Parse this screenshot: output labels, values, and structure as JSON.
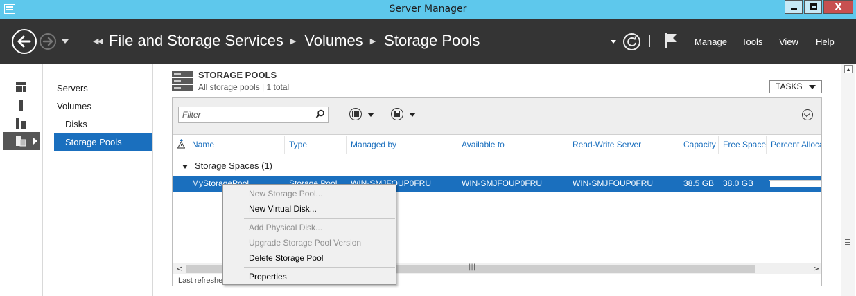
{
  "window": {
    "title": "Server Manager",
    "close_symbol": "X"
  },
  "header": {
    "breadcrumb": [
      "File and Storage Services",
      "Volumes",
      "Storage Pools"
    ],
    "menu": [
      "Manage",
      "Tools",
      "View",
      "Help"
    ]
  },
  "rail": {
    "icons": [
      "dashboard-icon",
      "local-server-icon",
      "all-servers-icon",
      "file-storage-icon"
    ]
  },
  "subnav": {
    "items": [
      {
        "label": "Servers"
      },
      {
        "label": "Volumes"
      },
      {
        "label": "Disks"
      },
      {
        "label": "Storage Pools"
      }
    ]
  },
  "tile": {
    "title": "STORAGE POOLS",
    "subtitle": "All storage pools | 1 total",
    "tasks_label": "TASKS"
  },
  "toolbar": {
    "filter_placeholder": "Filter"
  },
  "table": {
    "columns": [
      "Name",
      "Type",
      "Managed by",
      "Available to",
      "Read-Write Server",
      "Capacity",
      "Free Space",
      "Percent Allocated"
    ],
    "group_label": "Storage Spaces (1)",
    "row": {
      "name": "MyStoragePool",
      "type": "Storage Pool",
      "managed_by": "WIN-SMJFOUP0FRU",
      "available_to": "WIN-SMJFOUP0FRU",
      "rw_server": "WIN-SMJFOUP0FRU",
      "capacity": "38.5 GB",
      "free_space": "38.0 GB",
      "percent_allocated": 0.01
    },
    "last_refreshed": "Last refreshed"
  },
  "context_menu": {
    "items": [
      {
        "label": "New Storage Pool...",
        "enabled": false
      },
      {
        "label": "New Virtual Disk...",
        "enabled": true
      },
      {
        "label": "Add Physical Disk...",
        "enabled": false
      },
      {
        "label": "Upgrade Storage Pool Version",
        "enabled": false
      },
      {
        "label": "Delete Storage Pool",
        "enabled": true
      },
      {
        "label": "Properties",
        "enabled": true
      }
    ]
  },
  "colors": {
    "titlebar": "#5ec8ec",
    "header": "#343434",
    "accent": "#1a6fbe"
  }
}
